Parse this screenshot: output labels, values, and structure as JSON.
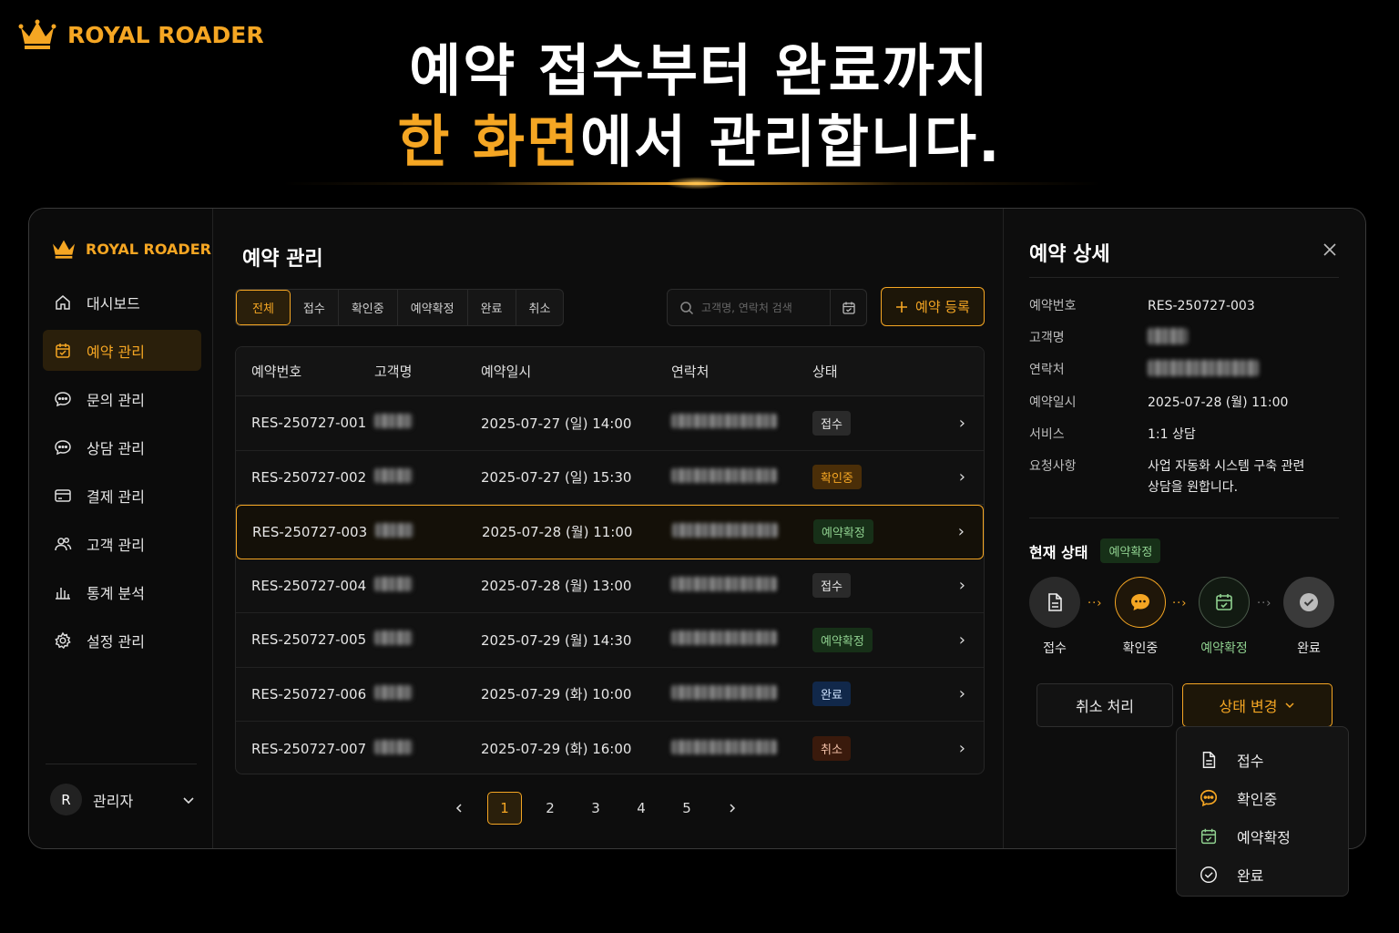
{
  "brand": {
    "name": "ROYAL ROADER",
    "color": "#f5a623"
  },
  "headline": {
    "line1": "예약 접수부터 완료까지",
    "line2_highlight": "한 화면",
    "line2_rest": "에서 관리합니다."
  },
  "sidebar": {
    "brand_name": "ROYAL ROADER",
    "items": [
      {
        "label": "대시보드",
        "icon": "home-icon"
      },
      {
        "label": "예약 관리",
        "icon": "calendar-icon",
        "active": true
      },
      {
        "label": "문의 관리",
        "icon": "chat-icon"
      },
      {
        "label": "상담 관리",
        "icon": "chat-icon"
      },
      {
        "label": "결제 관리",
        "icon": "card-icon"
      },
      {
        "label": "고객 관리",
        "icon": "users-icon"
      },
      {
        "label": "통계 분석",
        "icon": "chart-icon"
      },
      {
        "label": "설정 관리",
        "icon": "gear-icon"
      }
    ],
    "user": {
      "initial": "R",
      "name": "관리자"
    }
  },
  "main": {
    "title": "예약 관리",
    "tabs": [
      "전체",
      "접수",
      "확인중",
      "예약확정",
      "완료",
      "취소"
    ],
    "search_placeholder": "고객명, 연락처 검색",
    "add_label": "예약 등록",
    "columns": [
      "예약번호",
      "고객명",
      "예약일시",
      "연락처",
      "상태"
    ],
    "rows": [
      {
        "id": "RES-250727-001",
        "datetime": "2025-07-27 (일) 14:00",
        "status": "접수"
      },
      {
        "id": "RES-250727-002",
        "datetime": "2025-07-27 (일) 15:30",
        "status": "확인중"
      },
      {
        "id": "RES-250727-003",
        "datetime": "2025-07-28 (월) 11:00",
        "status": "예약확정",
        "selected": true
      },
      {
        "id": "RES-250727-004",
        "datetime": "2025-07-28 (월) 13:00",
        "status": "접수"
      },
      {
        "id": "RES-250727-005",
        "datetime": "2025-07-29 (월) 14:30",
        "status": "예약확정"
      },
      {
        "id": "RES-250727-006",
        "datetime": "2025-07-29 (화) 10:00",
        "status": "완료"
      },
      {
        "id": "RES-250727-007",
        "datetime": "2025-07-29 (화) 16:00",
        "status": "취소"
      }
    ],
    "pages": [
      "1",
      "2",
      "3",
      "4",
      "5"
    ],
    "current_page": "1"
  },
  "detail": {
    "title": "예약 상세",
    "fields": [
      {
        "key": "예약번호",
        "value": "RES-250727-003"
      },
      {
        "key": "고객명",
        "value": ""
      },
      {
        "key": "연락처",
        "value": ""
      },
      {
        "key": "예약일시",
        "value": "2025-07-28 (월) 11:00"
      },
      {
        "key": "서비스",
        "value": "1:1 상담"
      },
      {
        "key": "요청사항",
        "value": "사업 자동화 시스템 구축 관련 상담을 원합니다."
      }
    ],
    "current_label": "현재 상태",
    "current_status": "예약확정",
    "steps": [
      "접수",
      "확인중",
      "예약확정",
      "완료"
    ],
    "cancel_label": "취소 처리",
    "change_label": "상태 변경"
  },
  "dropdown": [
    "접수",
    "확인중",
    "예약확정",
    "완료"
  ]
}
